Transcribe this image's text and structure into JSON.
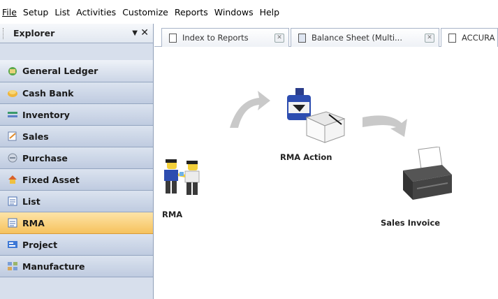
{
  "menu": [
    {
      "label": "File"
    },
    {
      "label": "Setup"
    },
    {
      "label": "List"
    },
    {
      "label": "Activities"
    },
    {
      "label": "Customize"
    },
    {
      "label": "Reports"
    },
    {
      "label": "Windows"
    },
    {
      "label": "Help"
    }
  ],
  "explorer": {
    "title": "Explorer",
    "pin_icon": "dropdown-arrow-icon",
    "close_icon": "close-icon",
    "items": [
      {
        "label": "General Ledger",
        "icon": "ledger-icon"
      },
      {
        "label": "Cash Bank",
        "icon": "cash-bank-icon"
      },
      {
        "label": "Inventory",
        "icon": "inventory-icon"
      },
      {
        "label": "Sales",
        "icon": "sales-icon"
      },
      {
        "label": "Purchase",
        "icon": "purchase-icon"
      },
      {
        "label": "Fixed Asset",
        "icon": "fixed-asset-icon"
      },
      {
        "label": "List",
        "icon": "list-icon"
      },
      {
        "label": "RMA",
        "icon": "rma-icon",
        "active": true
      },
      {
        "label": "Project",
        "icon": "project-icon"
      },
      {
        "label": "Manufacture",
        "icon": "manufacture-icon"
      }
    ]
  },
  "tabs": [
    {
      "label": "Index to Reports"
    },
    {
      "label": "Balance Sheet (Multi..."
    },
    {
      "label": "ACCURA"
    }
  ],
  "flow": {
    "rma": "RMA",
    "rma_action": "RMA Action",
    "sales_invoice": "Sales Invoice"
  },
  "colors": {
    "active_item": "#f6c25d",
    "panel": "#d7dfec",
    "arrow": "#c8c8c8"
  }
}
